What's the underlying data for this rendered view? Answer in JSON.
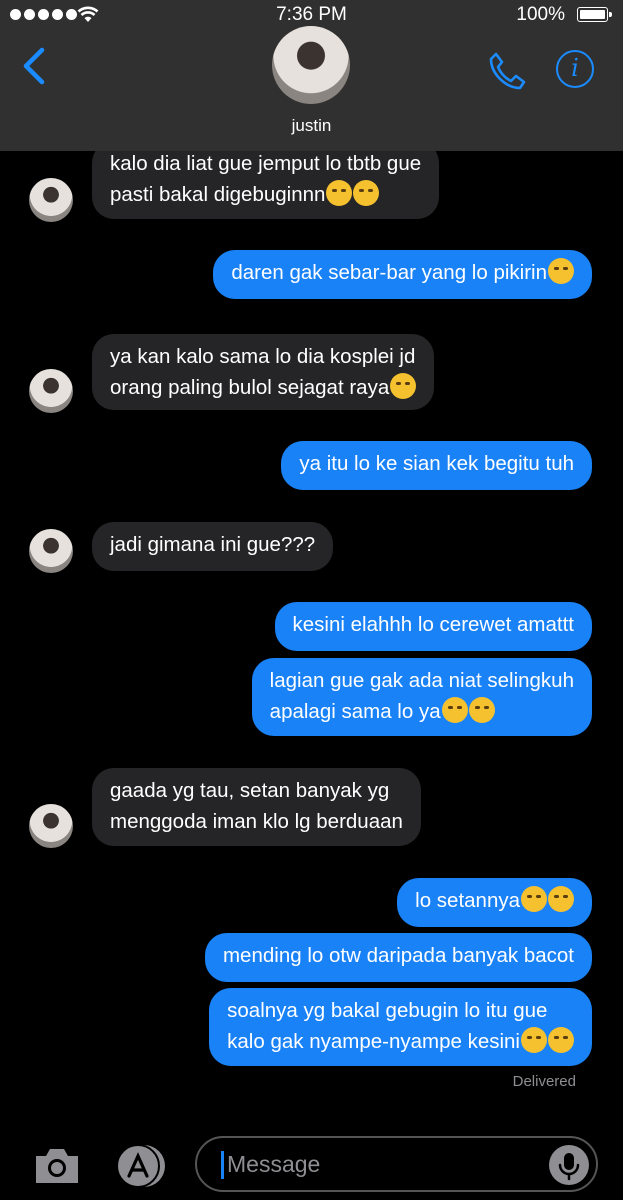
{
  "status": {
    "time": "7:36 PM",
    "battery": "100%"
  },
  "contact": {
    "name": "justin"
  },
  "messages": [
    {
      "dir": "in",
      "lines": [
        "kalo dia liat gue jemput lo tbtb gue",
        "pasti bakal digebuginnn"
      ],
      "emoji": 2
    },
    {
      "dir": "out",
      "lines": [
        "daren gak sebar-bar yang lo pikirin"
      ],
      "emoji": 1
    },
    {
      "dir": "in",
      "lines": [
        "ya kan kalo sama lo dia kosplei jd",
        "orang paling bulol sejagat raya"
      ],
      "emoji": 1
    },
    {
      "dir": "out",
      "lines": [
        "ya itu lo ke sian kek begitu tuh"
      ],
      "emoji": 0
    },
    {
      "dir": "in",
      "lines": [
        "jadi gimana ini gue???"
      ],
      "emoji": 0
    },
    {
      "dir": "out",
      "lines": [
        "kesini elahhh lo cerewet amattt"
      ],
      "emoji": 0
    },
    {
      "dir": "out",
      "lines": [
        "lagian gue gak ada niat selingkuh",
        "apalagi sama lo ya"
      ],
      "emoji": 2
    },
    {
      "dir": "in",
      "lines": [
        "gaada yg tau, setan banyak yg",
        "menggoda iman klo lg berduaan"
      ],
      "emoji": 0
    },
    {
      "dir": "out",
      "lines": [
        "lo setannya"
      ],
      "emoji": 2
    },
    {
      "dir": "out",
      "lines": [
        "mending lo otw daripada banyak bacot"
      ],
      "emoji": 0
    },
    {
      "dir": "out",
      "lines": [
        "soalnya yg bakal gebugin lo itu gue",
        "kalo gak nyampe-nyampe kesini"
      ],
      "emoji": 2
    }
  ],
  "delivered": "Delivered",
  "input": {
    "placeholder": "Message"
  },
  "colors": {
    "accent": "#1a82f7",
    "incoming": "#252527",
    "header": "#303030"
  }
}
